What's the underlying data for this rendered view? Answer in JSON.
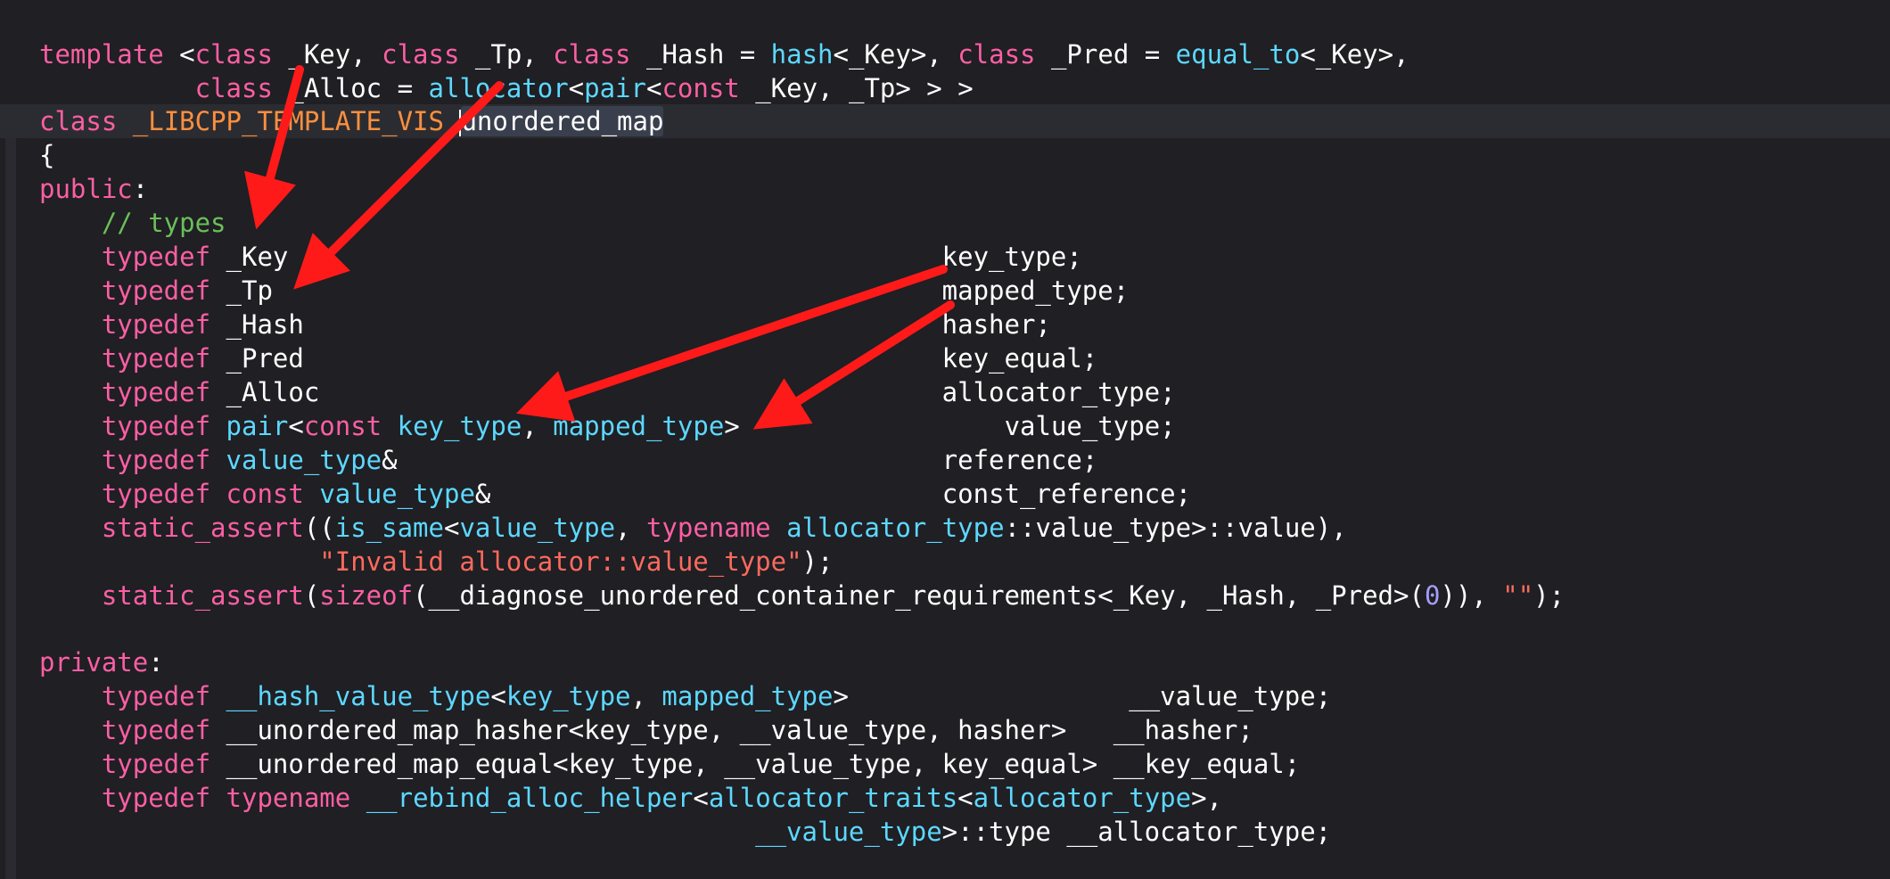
{
  "editor": {
    "lines": [
      {
        "id": "l1",
        "tokens": [
          {
            "t": "kw",
            "v": "template"
          },
          {
            "t": "plain",
            "v": " <"
          },
          {
            "t": "kw",
            "v": "class"
          },
          {
            "t": "plain",
            "v": " _Key, "
          },
          {
            "t": "kw",
            "v": "class"
          },
          {
            "t": "plain",
            "v": " _Tp, "
          },
          {
            "t": "kw",
            "v": "class"
          },
          {
            "t": "plain",
            "v": " _Hash = "
          },
          {
            "t": "ty",
            "v": "hash"
          },
          {
            "t": "plain",
            "v": "<_Key>, "
          },
          {
            "t": "kw",
            "v": "class"
          },
          {
            "t": "plain",
            "v": " _Pred = "
          },
          {
            "t": "ty",
            "v": "equal_to"
          },
          {
            "t": "plain",
            "v": "<_Key>,"
          }
        ]
      },
      {
        "id": "l2",
        "tokens": [
          {
            "t": "plain",
            "v": "          "
          },
          {
            "t": "kw",
            "v": "class"
          },
          {
            "t": "plain",
            "v": " _Alloc = "
          },
          {
            "t": "ty",
            "v": "allocator"
          },
          {
            "t": "plain",
            "v": "<"
          },
          {
            "t": "ty",
            "v": "pair"
          },
          {
            "t": "plain",
            "v": "<"
          },
          {
            "t": "kw",
            "v": "const"
          },
          {
            "t": "plain",
            "v": " _Key, _Tp> > >"
          }
        ]
      },
      {
        "id": "l3",
        "tokens": [
          {
            "t": "kw",
            "v": "class"
          },
          {
            "t": "plain",
            "v": " "
          },
          {
            "t": "pre",
            "v": "_LIBCPP_TEMPLATE_VIS"
          },
          {
            "t": "plain",
            "v": " "
          },
          {
            "t": "cursor",
            "v": ""
          },
          {
            "t": "sel",
            "v": "unordered_map"
          }
        ]
      },
      {
        "id": "l4",
        "tokens": [
          {
            "t": "plain",
            "v": "{"
          }
        ]
      },
      {
        "id": "l5",
        "tokens": [
          {
            "t": "kw",
            "v": "public"
          },
          {
            "t": "plain",
            "v": ":"
          }
        ]
      },
      {
        "id": "l6",
        "tokens": [
          {
            "t": "plain",
            "v": "    "
          },
          {
            "t": "cm",
            "v": "// types"
          }
        ]
      },
      {
        "id": "l7",
        "tokens": [
          {
            "t": "plain",
            "v": "    "
          },
          {
            "t": "kw",
            "v": "typedef"
          },
          {
            "t": "plain",
            "v": " _Key                                          key_type;"
          }
        ]
      },
      {
        "id": "l8",
        "tokens": [
          {
            "t": "plain",
            "v": "    "
          },
          {
            "t": "kw",
            "v": "typedef"
          },
          {
            "t": "plain",
            "v": " _Tp                                           mapped_type;"
          }
        ]
      },
      {
        "id": "l9",
        "tokens": [
          {
            "t": "plain",
            "v": "    "
          },
          {
            "t": "kw",
            "v": "typedef"
          },
          {
            "t": "plain",
            "v": " _Hash                                         hasher;"
          }
        ]
      },
      {
        "id": "l10",
        "tokens": [
          {
            "t": "plain",
            "v": "    "
          },
          {
            "t": "kw",
            "v": "typedef"
          },
          {
            "t": "plain",
            "v": " _Pred                                         key_equal;"
          }
        ]
      },
      {
        "id": "l11",
        "tokens": [
          {
            "t": "plain",
            "v": "    "
          },
          {
            "t": "kw",
            "v": "typedef"
          },
          {
            "t": "plain",
            "v": " _Alloc                                        allocator_type;"
          }
        ]
      },
      {
        "id": "l12",
        "tokens": [
          {
            "t": "plain",
            "v": "    "
          },
          {
            "t": "kw",
            "v": "typedef"
          },
          {
            "t": "plain",
            "v": " "
          },
          {
            "t": "ty",
            "v": "pair"
          },
          {
            "t": "plain",
            "v": "<"
          },
          {
            "t": "kw",
            "v": "const"
          },
          {
            "t": "plain",
            "v": " "
          },
          {
            "t": "ty",
            "v": "key_type"
          },
          {
            "t": "plain",
            "v": ", "
          },
          {
            "t": "ty",
            "v": "mapped_type"
          },
          {
            "t": "plain",
            "v": ">                 value_type;"
          }
        ]
      },
      {
        "id": "l13",
        "tokens": [
          {
            "t": "plain",
            "v": "    "
          },
          {
            "t": "kw",
            "v": "typedef"
          },
          {
            "t": "plain",
            "v": " "
          },
          {
            "t": "ty",
            "v": "value_type"
          },
          {
            "t": "plain",
            "v": "&                                   reference;"
          }
        ]
      },
      {
        "id": "l14",
        "tokens": [
          {
            "t": "plain",
            "v": "    "
          },
          {
            "t": "kw",
            "v": "typedef"
          },
          {
            "t": "plain",
            "v": " "
          },
          {
            "t": "kw",
            "v": "const"
          },
          {
            "t": "plain",
            "v": " "
          },
          {
            "t": "ty",
            "v": "value_type"
          },
          {
            "t": "plain",
            "v": "&                             const_reference;"
          }
        ]
      },
      {
        "id": "l15",
        "tokens": [
          {
            "t": "plain",
            "v": "    "
          },
          {
            "t": "kw",
            "v": "static_assert"
          },
          {
            "t": "plain",
            "v": "(("
          },
          {
            "t": "ty",
            "v": "is_same"
          },
          {
            "t": "plain",
            "v": "<"
          },
          {
            "t": "ty",
            "v": "value_type"
          },
          {
            "t": "plain",
            "v": ", "
          },
          {
            "t": "kw",
            "v": "typename"
          },
          {
            "t": "plain",
            "v": " "
          },
          {
            "t": "ty",
            "v": "allocator_type"
          },
          {
            "t": "plain",
            "v": "::value_type>::value),"
          }
        ]
      },
      {
        "id": "l16",
        "tokens": [
          {
            "t": "plain",
            "v": "                  "
          },
          {
            "t": "st",
            "v": "\"Invalid allocator::value_type\""
          },
          {
            "t": "plain",
            "v": ");"
          }
        ]
      },
      {
        "id": "l17",
        "tokens": [
          {
            "t": "plain",
            "v": "    "
          },
          {
            "t": "kw",
            "v": "static_assert"
          },
          {
            "t": "plain",
            "v": "("
          },
          {
            "t": "kw",
            "v": "sizeof"
          },
          {
            "t": "plain",
            "v": "(__diagnose_unordered_container_requirements<_Key, _Hash, _Pred>("
          },
          {
            "t": "num",
            "v": "0"
          },
          {
            "t": "plain",
            "v": ")), "
          },
          {
            "t": "st",
            "v": "\"\""
          },
          {
            "t": "plain",
            "v": ");"
          }
        ]
      },
      {
        "id": "l18",
        "tokens": [
          {
            "t": "plain",
            "v": ""
          }
        ]
      },
      {
        "id": "l19",
        "tokens": [
          {
            "t": "kw",
            "v": "private"
          },
          {
            "t": "plain",
            "v": ":"
          }
        ]
      },
      {
        "id": "l20",
        "tokens": [
          {
            "t": "plain",
            "v": "    "
          },
          {
            "t": "kw",
            "v": "typedef"
          },
          {
            "t": "plain",
            "v": " "
          },
          {
            "t": "ty",
            "v": "__hash_value_type"
          },
          {
            "t": "plain",
            "v": "<"
          },
          {
            "t": "ty",
            "v": "key_type"
          },
          {
            "t": "plain",
            "v": ", "
          },
          {
            "t": "ty",
            "v": "mapped_type"
          },
          {
            "t": "plain",
            "v": ">                  __value_type;"
          }
        ]
      },
      {
        "id": "l21",
        "tokens": [
          {
            "t": "plain",
            "v": "    "
          },
          {
            "t": "kw",
            "v": "typedef"
          },
          {
            "t": "plain",
            "v": " __unordered_map_hasher<key_type, __value_type, hasher>   __hasher;"
          }
        ]
      },
      {
        "id": "l22",
        "tokens": [
          {
            "t": "plain",
            "v": "    "
          },
          {
            "t": "kw",
            "v": "typedef"
          },
          {
            "t": "plain",
            "v": " __unordered_map_equal<key_type, __value_type, key_equal> __key_equal;"
          }
        ]
      },
      {
        "id": "l23",
        "tokens": [
          {
            "t": "plain",
            "v": "    "
          },
          {
            "t": "kw",
            "v": "typedef"
          },
          {
            "t": "plain",
            "v": " "
          },
          {
            "t": "kw",
            "v": "typename"
          },
          {
            "t": "plain",
            "v": " "
          },
          {
            "t": "ty",
            "v": "__rebind_alloc_helper"
          },
          {
            "t": "plain",
            "v": "<"
          },
          {
            "t": "ty",
            "v": "allocator_traits"
          },
          {
            "t": "plain",
            "v": "<"
          },
          {
            "t": "ty",
            "v": "allocator_type"
          },
          {
            "t": "plain",
            "v": ">,"
          }
        ]
      },
      {
        "id": "l24",
        "tokens": [
          {
            "t": "plain",
            "v": "                                              "
          },
          {
            "t": "ty",
            "v": "__value_type"
          },
          {
            "t": "plain",
            "v": ">::type __allocator_type;"
          }
        ]
      }
    ]
  },
  "colors": {
    "background": "#1f1f24",
    "keyword": "#fc5fa3",
    "type": "#5dd8ff",
    "preprocessor": "#fd8f3f",
    "comment": "#6bbf59",
    "string": "#fc6a5d",
    "number": "#a79df9",
    "annotation_arrow": "#ff1a1a"
  }
}
